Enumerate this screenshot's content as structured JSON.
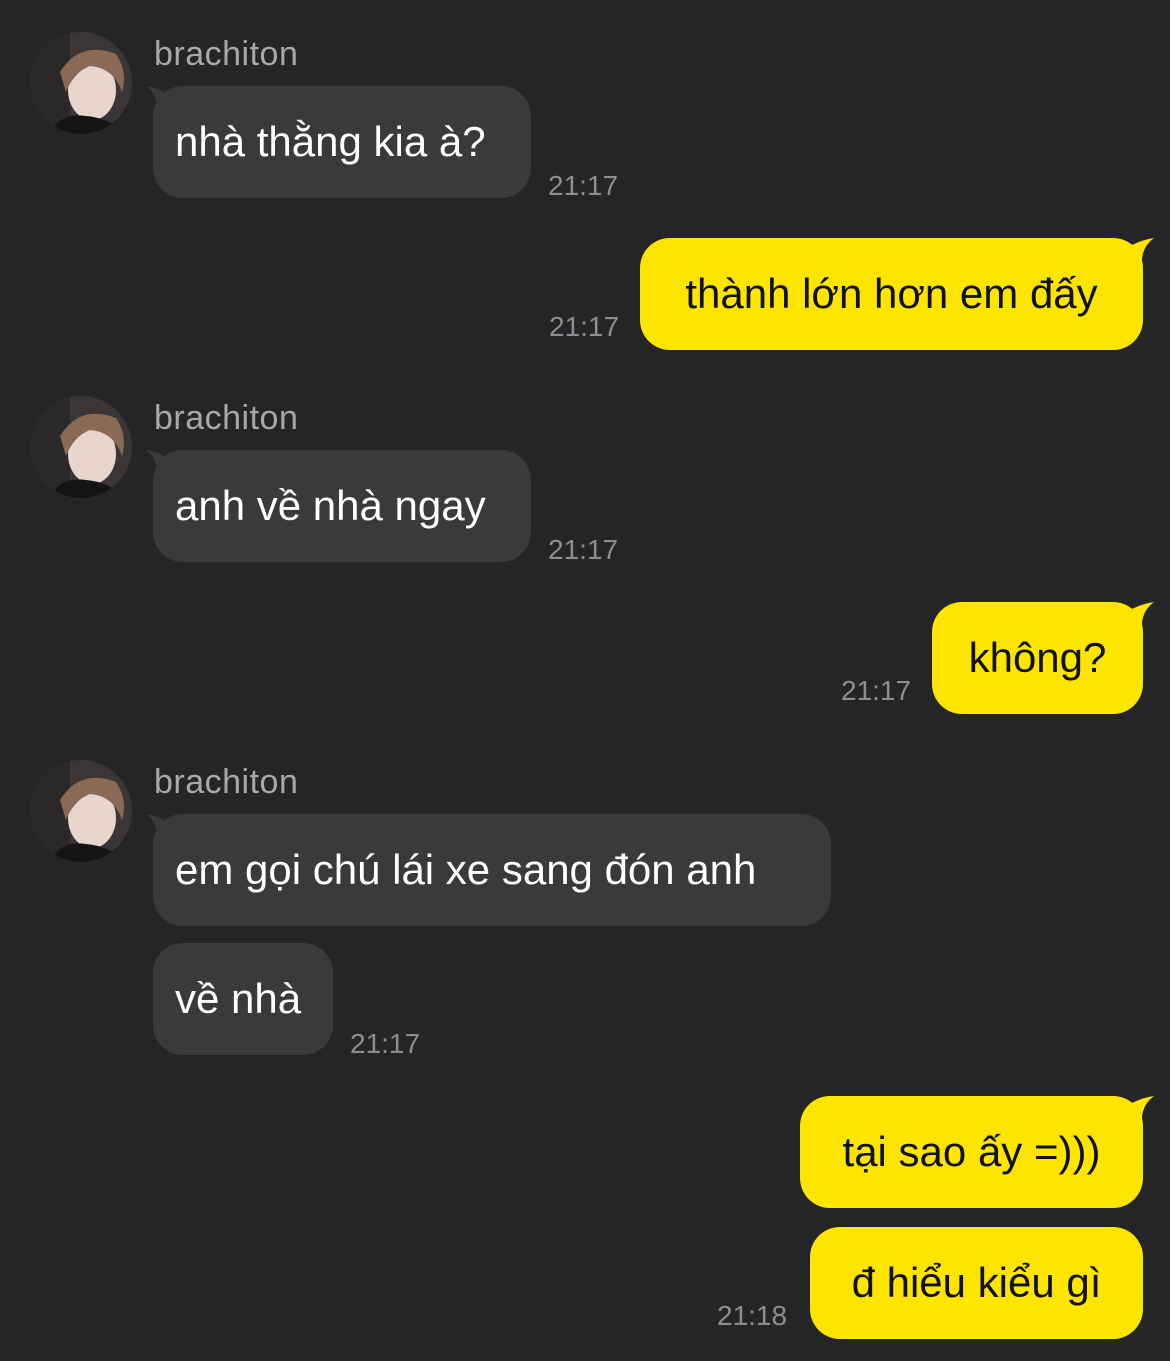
{
  "chat": {
    "colors": {
      "background": "#252527",
      "incoming_bubble": "#3a3a3c",
      "outgoing_bubble": "#fde500",
      "timestamp": "#8e8e92"
    },
    "groups": [
      {
        "sender": "brachiton",
        "messages": [
          {
            "text": "nhà thằng kia à?",
            "time": "21:17"
          }
        ]
      },
      {
        "outgoing": true,
        "messages": [
          {
            "text": "thành lớn hơn em đấy",
            "time": "21:17"
          }
        ]
      },
      {
        "sender": "brachiton",
        "messages": [
          {
            "text": "anh về nhà ngay",
            "time": "21:17"
          }
        ]
      },
      {
        "outgoing": true,
        "messages": [
          {
            "text": "không?",
            "time": "21:17"
          }
        ]
      },
      {
        "sender": "brachiton",
        "messages": [
          {
            "text": "em gọi chú lái xe sang đón anh"
          },
          {
            "text": "về nhà",
            "time": "21:17"
          }
        ]
      },
      {
        "outgoing": true,
        "messages": [
          {
            "text": "tại sao ấy =)))"
          },
          {
            "text": "đ hiểu kiểu gì",
            "time": "21:18"
          }
        ]
      }
    ]
  }
}
